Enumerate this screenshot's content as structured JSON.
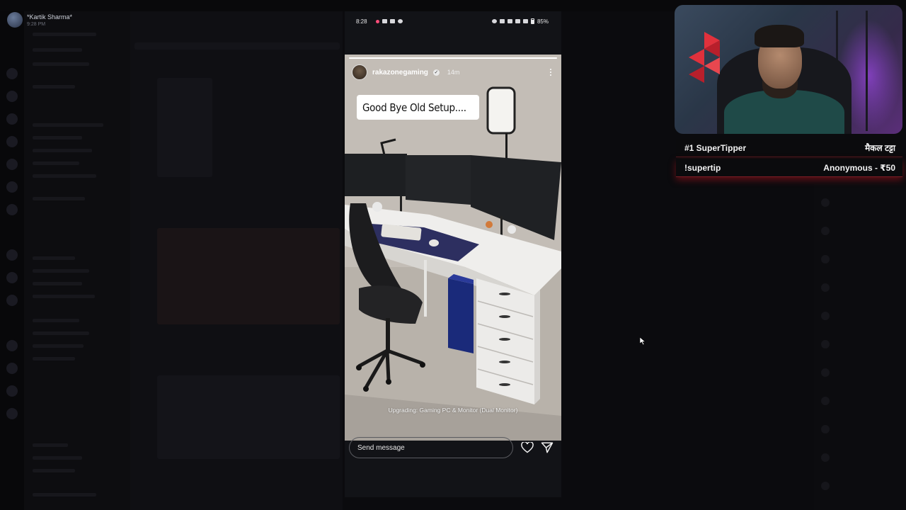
{
  "background_app": {
    "user_name": "*Kartik Sharma*",
    "user_time": "9:28 PM"
  },
  "phone": {
    "status": {
      "time": "8:28",
      "battery": "85%"
    },
    "story": {
      "username": "rakazonegaming",
      "time_ago": "14m",
      "caption": "Good Bye Old Setup....",
      "bottom_caption": "Upgrading: Gaming PC & Monitor (Dual Monitor)",
      "progress": 1.0
    },
    "reply": {
      "placeholder": "Send message"
    }
  },
  "overlay": {
    "tip_rows": [
      {
        "left": "#1 SuperTipper",
        "right": "मैकल टट्टा"
      },
      {
        "left": "!supertip",
        "right": "Anonymous - ₹50"
      }
    ]
  },
  "icons": {
    "like": "heart-icon",
    "share": "send-icon",
    "more": "more-icon",
    "verified": "verified-icon"
  },
  "colors": {
    "tip_accent": "#7a1d24",
    "brand_logo": "#e0313c",
    "cam_glow": "#9646dc"
  }
}
